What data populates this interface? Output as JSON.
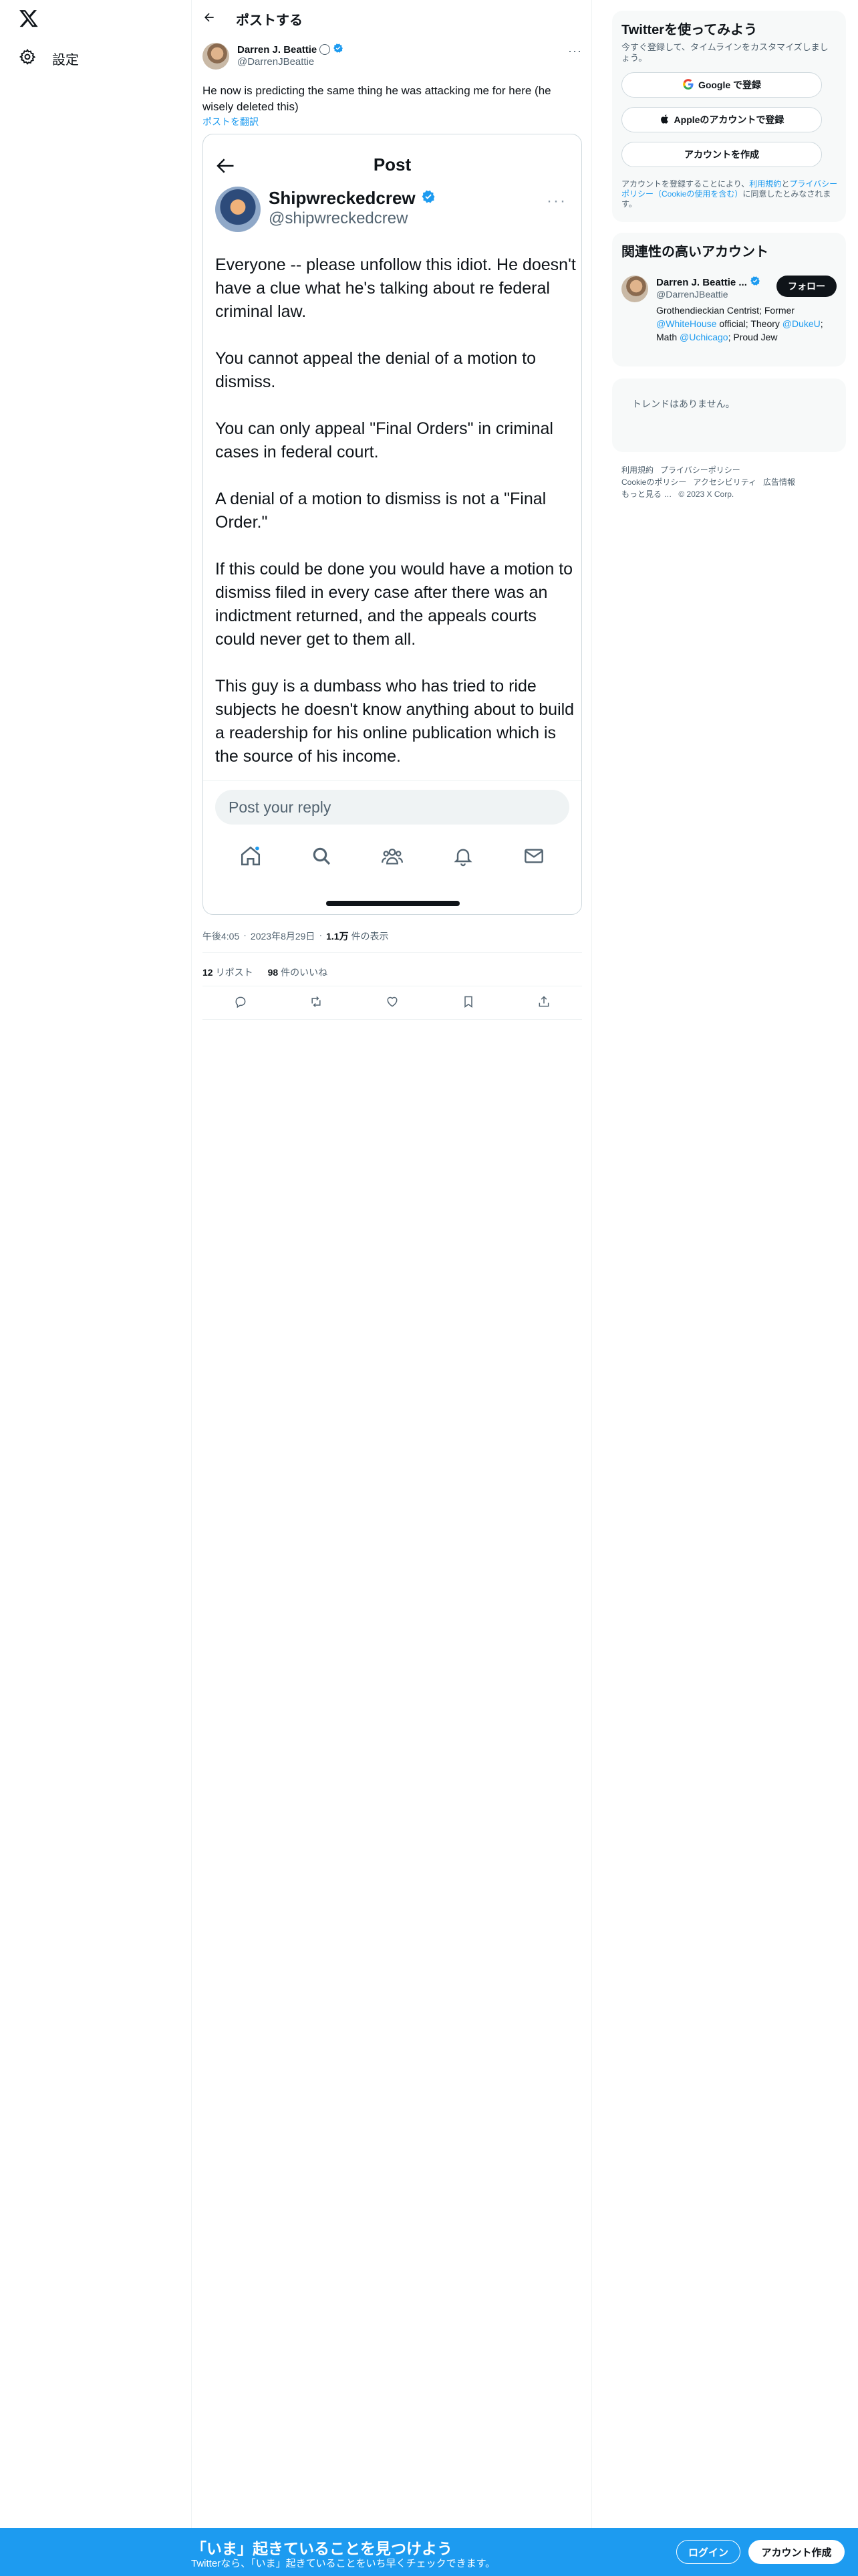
{
  "nav": {
    "settings_label": "設定"
  },
  "header": {
    "title": "ポストする"
  },
  "tweet": {
    "author_name": "Darren J. Beattie",
    "author_handle": "@DarrenJBeattie",
    "text": "He now is predicting the same thing he was attacking me for here (he wisely deleted this)",
    "translate_label": "ポストを翻訳",
    "time": "午後4:05",
    "date": "2023年8月29日",
    "views_count": "1.1万",
    "views_label": "件の表示",
    "reposts_count": "12",
    "reposts_label": "リポスト",
    "likes_count": "98",
    "likes_label": "件のいいね",
    "meta_separator": "·"
  },
  "embedded": {
    "header_title": "Post",
    "author_name": "Shipwreckedcrew",
    "author_handle": "@shipwreckedcrew",
    "paragraphs": [
      "Everyone -- please unfollow this idiot.    He doesn't have a clue what he's talking about re federal criminal law.",
      "You cannot appeal the denial of a motion to dismiss.",
      "You can only appeal \"Final Orders\" in criminal cases in federal court.",
      " A denial of a motion to dismiss is not a \"Final Order.\"",
      "If this could be done you would have a motion to dismiss filed in every case after there was an indictment returned, and the appeals courts could never get to them all.",
      "This guy is a dumbass who has tried to ride subjects he doesn't know anything about to build a readership for his online publication which is the source of his income."
    ],
    "reply_placeholder": "Post your reply"
  },
  "signup_card": {
    "title": "Twitterを使ってみよう",
    "subtitle": "今すぐ登録して、タイムラインをカスタマイズしましょう。",
    "google_label": "Google で登録",
    "apple_label": "Appleのアカウントで登録",
    "create_label": "アカウントを作成",
    "terms_prefix": "アカウントを登録することにより、",
    "terms_link1": "利用規約",
    "terms_and": "と",
    "terms_link2": "プライバシーポリシー",
    "terms_link3": "（Cookieの使用を含む）",
    "terms_suffix": "に同意したとみなされます。"
  },
  "related": {
    "title": "関連性の高いアカウント",
    "name": "Darren J. Beattie ...",
    "handle": "@DarrenJBeattie",
    "follow_label": "フォロー",
    "bio_1": "Grothendieckian Centrist; Former ",
    "bio_mention1": "@WhiteHouse",
    "bio_2": " official; Theory ",
    "bio_mention2": "@DukeU",
    "bio_3": "; Math ",
    "bio_mention3": "@Uchicago",
    "bio_4": "; Proud Jew"
  },
  "trends": {
    "empty_text": "トレンドはありません。"
  },
  "footer": {
    "links": [
      "利用規約",
      "プライバシーポリシー",
      "Cookieのポリシー",
      "アクセシビリティ",
      "広告情報",
      "もっと見る …"
    ],
    "copyright": "© 2023 X Corp."
  },
  "banner": {
    "title": "「いま」起きていることを見つけよう",
    "subtitle": "Twitterなら、「いま」起きていることをいち早くチェックできます。",
    "login_label": "ログイン",
    "signup_label": "アカウント作成"
  },
  "icons": {
    "logo": "x-logo-icon",
    "settings": "gear-icon",
    "back": "arrow-left-icon",
    "verified": "verified-badge-icon",
    "reply": "reply-icon",
    "repost": "repost-icon",
    "like": "heart-icon",
    "bookmark": "bookmark-icon",
    "share": "share-icon"
  },
  "colors": {
    "accent": "#1d9bf0",
    "text": "#0f1419",
    "muted": "#536471"
  }
}
